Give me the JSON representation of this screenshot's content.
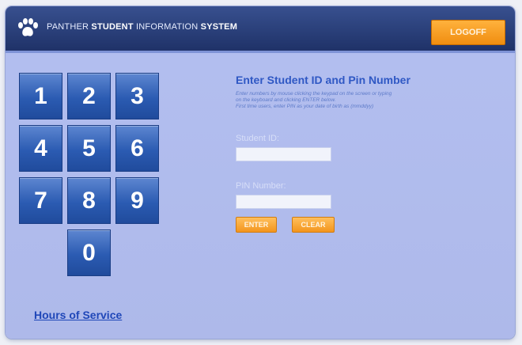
{
  "header": {
    "title_prefix": "PANTHER ",
    "title_bold_1": "STUDENT",
    "title_mid": " INFORMATION ",
    "title_bold_2": "SYSTEM",
    "logoff_label": "LOGOFF"
  },
  "keypad": {
    "keys": [
      "1",
      "2",
      "3",
      "4",
      "5",
      "6",
      "7",
      "8",
      "9",
      "0"
    ]
  },
  "footer": {
    "hours_link": "Hours of Service"
  },
  "form": {
    "title": "Enter Student ID and Pin Number",
    "instructions": [
      "Enter numbers by mouse clicking the keypad on the screen or typing",
      "on the keyboard and clicking ENTER below.",
      "First time users, enter PIN as your date of birth as (mmddyy)"
    ],
    "student_id_label": "Student ID:",
    "student_id_value": "",
    "pin_label": "PIN Number:",
    "pin_value": "",
    "enter_label": "ENTER",
    "clear_label": "CLEAR"
  },
  "colors": {
    "header_bg": "#26386f",
    "panel_bg": "#b0bcef",
    "key_blue": "#2b5bb2",
    "accent_orange": "#f39a1f",
    "title_blue": "#2f58c4"
  }
}
